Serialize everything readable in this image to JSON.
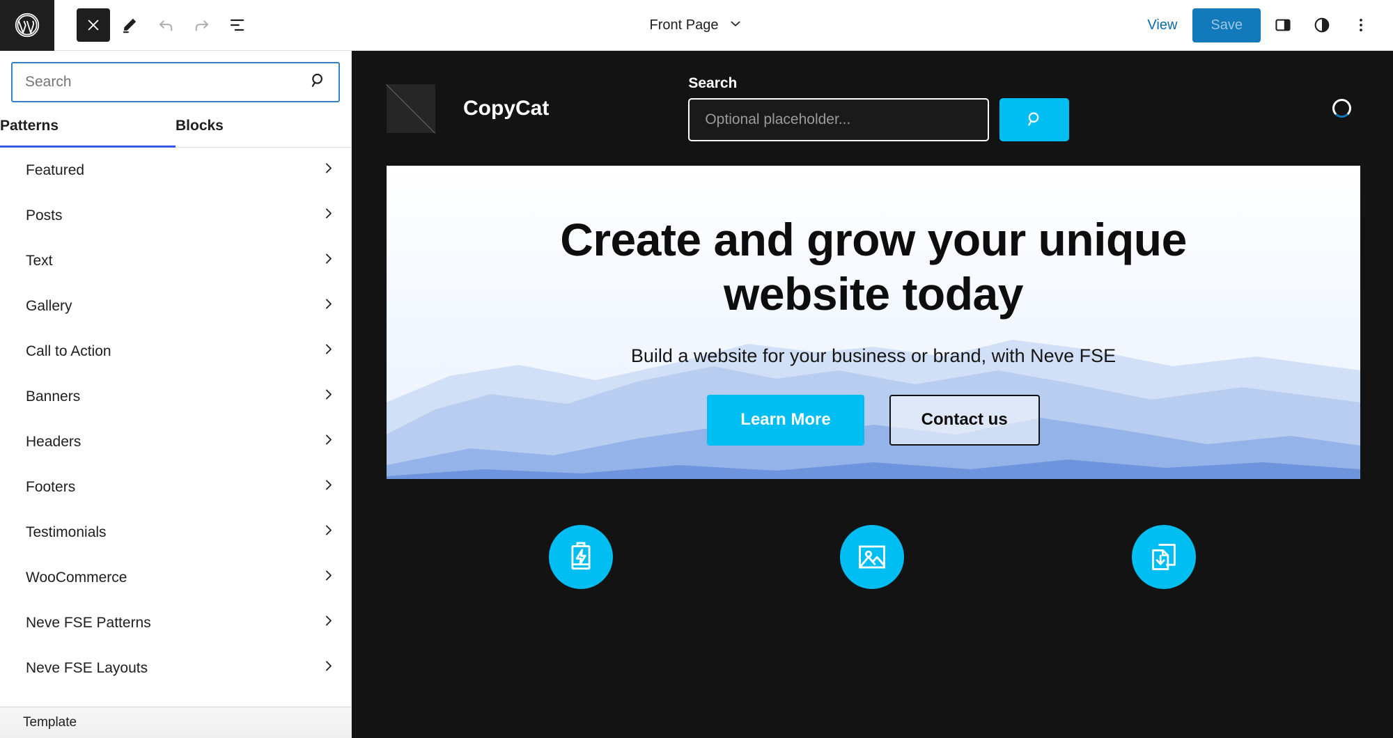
{
  "editor": {
    "logo_icon": "wordpress-logo-icon",
    "tools": [
      {
        "name": "close-inserter-button",
        "icon": "close-icon"
      },
      {
        "name": "edit-mode-button",
        "icon": "pencil-icon"
      },
      {
        "name": "undo-button",
        "icon": "undo-arrow-icon"
      },
      {
        "name": "redo-button",
        "icon": "redo-arrow-icon"
      },
      {
        "name": "list-view-button",
        "icon": "list-view-icon"
      }
    ],
    "document_title": "Front Page",
    "document_title_icon": "chevron-down-icon",
    "view_label": "View",
    "save_label": "Save",
    "sidebar_toggle_icon": "settings-panel-icon",
    "styles_icon": "contrast-half-circle-icon",
    "options_icon": "vertical-ellipsis-icon"
  },
  "inserter": {
    "search": {
      "placeholder": "Search",
      "value": "",
      "icon": "search-magnifier-icon"
    },
    "tabs": [
      {
        "label": "Patterns",
        "active": true
      },
      {
        "label": "Blocks",
        "active": false
      }
    ],
    "categories": [
      {
        "label": "Featured"
      },
      {
        "label": "Posts"
      },
      {
        "label": "Text"
      },
      {
        "label": "Gallery"
      },
      {
        "label": "Call to Action"
      },
      {
        "label": "Banners"
      },
      {
        "label": "Headers"
      },
      {
        "label": "Footers"
      },
      {
        "label": "Testimonials"
      },
      {
        "label": "WooCommerce"
      },
      {
        "label": "Neve FSE Patterns"
      },
      {
        "label": "Neve FSE Layouts"
      }
    ],
    "category_chevron_icon": "chevron-right-icon",
    "breadcrumb": "Template"
  },
  "preview": {
    "header": {
      "logo_placeholder_icon": "image-placeholder-icon",
      "site_name": "CopyCat",
      "search_label": "Search",
      "search_placeholder": "Optional placeholder...",
      "search_button_icon": "search-magnifier-icon",
      "spinner_icon": "loading-spinner-icon"
    },
    "hero": {
      "heading": "Create and grow your unique website today",
      "subheading": "Build a website for your business or brand, with Neve FSE",
      "primary_button": "Learn More",
      "secondary_button": "Contact us"
    },
    "features": [
      {
        "icon": "battery-lightning-icon"
      },
      {
        "icon": "image-gallery-icon"
      },
      {
        "icon": "document-download-icon"
      }
    ]
  },
  "colors": {
    "accent_cyan": "#00bdf2",
    "wp_blue": "#3582c4",
    "save_blue": "#1279ba",
    "tab_active": "#3858e9",
    "canvas_dark": "#131313"
  }
}
